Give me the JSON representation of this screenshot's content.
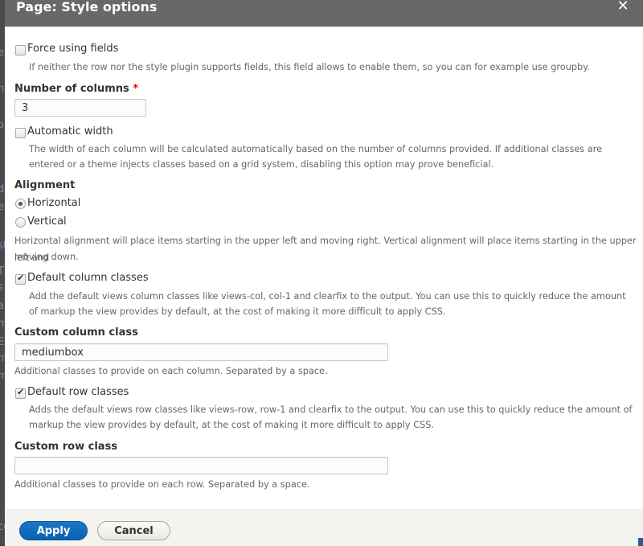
{
  "dialog": {
    "title": "Page: Style options",
    "close_label": "✕"
  },
  "background_fragments": [
    "e",
    "n",
    "o",
    "d",
    "e",
    "st",
    "TI",
    "s",
    "a",
    "m",
    "El",
    "m",
    "m",
    "co"
  ],
  "form": {
    "force_fields": {
      "label": "Force using fields",
      "checked": false,
      "description": "If neither the row nor the style plugin supports fields, this field allows to enable them, so you can for example use groupby."
    },
    "columns": {
      "label": "Number of columns",
      "required_marker": "*",
      "value": "3"
    },
    "automatic_width": {
      "label": "Automatic width",
      "checked": false,
      "description_line1": "The width of each column will be calculated automatically based on the number of columns provided. If additional classes are",
      "description_line2": "entered or a theme injects classes based on a grid system, disabling this option may prove beneficial."
    },
    "alignment": {
      "label": "Alignment",
      "options": [
        {
          "label": "Horizontal",
          "selected": true
        },
        {
          "label": "Vertical",
          "selected": false
        }
      ],
      "description_line1": "Horizontal alignment will place items starting in the upper left and moving right. Vertical alignment will place items starting in the upper left and",
      "description_line2": "moving down."
    },
    "default_column_classes": {
      "label": "Default column classes",
      "checked": true,
      "description_line1": "Add the default views column classes like views-col, col-1 and clearfix to the output. You can use this to quickly reduce the amount",
      "description_line2": "of markup the view provides by default, at the cost of making it more difficult to apply CSS."
    },
    "custom_column_class": {
      "label": "Custom column class",
      "value": "mediumbox",
      "description": "Additional classes to provide on each column. Separated by a space."
    },
    "default_row_classes": {
      "label": "Default row classes",
      "checked": true,
      "description_line1": "Adds the default views row classes like views-row, row-1 and clearfix to the output. You can use this to quickly reduce the amount of",
      "description_line2": "markup the view provides by default, at the cost of making it more difficult to apply CSS."
    },
    "custom_row_class": {
      "label": "Custom row class",
      "value": "",
      "description": "Additional classes to provide on each row. Separated by a space."
    }
  },
  "footer": {
    "apply_label": "Apply",
    "cancel_label": "Cancel"
  },
  "colors": {
    "titlebar": "#686868",
    "primary_button": "#0a60b0",
    "footer_bg": "#f3f3ef",
    "required": "#ee0000"
  }
}
